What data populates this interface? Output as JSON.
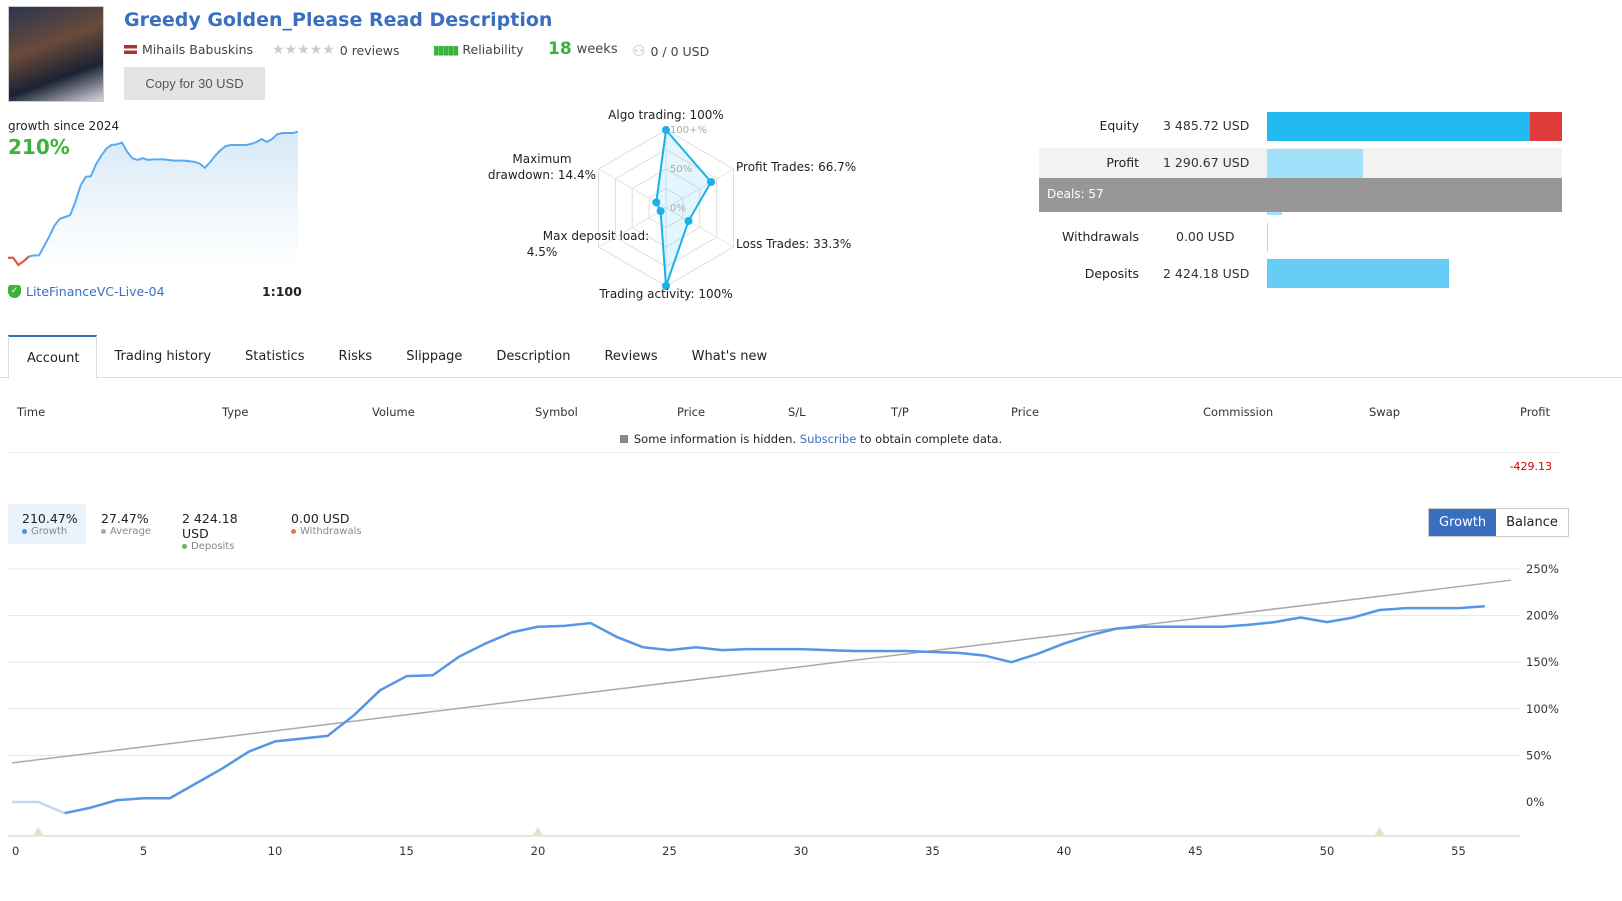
{
  "header": {
    "title": "Greedy Golden_Please Read Description",
    "author": "Mihails Babuskins",
    "reviews": "0 reviews",
    "reliability": "Reliability",
    "weeks_num": "18",
    "weeks_label": "weeks",
    "subscribers": "0 / 0 USD",
    "copy_button": "Copy for 30 USD",
    "rating_stars": 0
  },
  "summary": {
    "growth_label": "growth since 2024",
    "growth_value": "210%",
    "server": "LiteFinanceVC-Live-04",
    "leverage": "1:100"
  },
  "radar": {
    "labels": [
      "Algo trading: 100%",
      "Profit Trades: 66.7%",
      "Loss Trades: 33.3%",
      "Trading activity: 100%",
      "Max deposit load: 4.5%",
      "Maximum drawdown: 14.4%"
    ],
    "values": [
      100,
      66.7,
      33.3,
      100,
      4.5,
      14.4
    ],
    "scale": [
      "100+%",
      "50%",
      "0%"
    ]
  },
  "balance": {
    "equity_label": "Equity",
    "equity": "3 485.72 USD",
    "profit_label": "Profit",
    "profit": "1 290.67 USD",
    "deals": "Deals: 57",
    "withdrawals_label": "Withdrawals",
    "withdrawals": "0.00 USD",
    "deposits_label": "Deposits",
    "deposits": "2 424.18 USD",
    "colors": {
      "equity": "#22b8f0",
      "loss": "#e03c3c",
      "profit": "#a0e0f8",
      "deposits": "#66ccf5"
    }
  },
  "tabs": [
    "Account",
    "Trading history",
    "Statistics",
    "Risks",
    "Slippage",
    "Description",
    "Reviews",
    "What's new"
  ],
  "table": {
    "columns": [
      "Time",
      "Type",
      "Volume",
      "Symbol",
      "Price",
      "S/L",
      "T/P",
      "Price",
      "Commission",
      "Swap",
      "Profit"
    ],
    "notice_pre": "Some information is hidden.",
    "notice_link": "Subscribe",
    "notice_post": "to obtain complete data.",
    "total_profit": "-429.13"
  },
  "stats": [
    {
      "value": "210.47%",
      "label": "Growth",
      "color": "#4a90e2"
    },
    {
      "value": "27.47%",
      "label": "Average",
      "color": "#aaaaaa"
    },
    {
      "value": "2 424.18 USD",
      "label": "Deposits",
      "color": "#66bb44"
    },
    {
      "value": "0.00 USD",
      "label": "Withdrawals",
      "color": "#f07040"
    }
  ],
  "toggle": {
    "growth": "Growth",
    "balance": "Balance"
  },
  "chart_data": {
    "type": "line",
    "x": [
      0,
      1,
      2,
      3,
      4,
      5,
      6,
      7,
      8,
      9,
      10,
      11,
      12,
      13,
      14,
      15,
      16,
      17,
      18,
      19,
      20,
      21,
      22,
      23,
      24,
      25,
      26,
      27,
      28,
      29,
      30,
      31,
      32,
      33,
      34,
      35,
      36,
      37,
      38,
      39,
      40,
      41,
      42,
      43,
      44,
      45,
      46,
      47,
      48,
      49,
      50,
      51,
      52,
      53,
      54,
      55,
      56
    ],
    "series": [
      {
        "name": "Growth",
        "values": [
          0,
          0,
          -12,
          -6,
          2,
          4,
          4,
          20,
          36,
          54,
          65,
          68,
          71,
          93,
          120,
          135,
          136,
          156,
          170,
          182,
          188,
          189,
          192,
          177,
          166,
          163,
          166,
          163,
          164,
          164,
          164,
          163,
          162,
          162,
          162,
          161,
          160,
          157,
          150,
          159,
          170,
          179,
          186,
          188,
          188,
          188,
          188,
          190,
          193,
          198,
          193,
          198,
          206,
          208,
          208,
          208,
          210
        ],
        "color": "#5596e6"
      },
      {
        "name": "Average",
        "values_trend": [
          42,
          238
        ],
        "color": "#aaaaaa"
      }
    ],
    "xlim": [
      0,
      57
    ],
    "ylim": [
      0,
      250
    ],
    "xticks": [
      0,
      5,
      10,
      15,
      20,
      25,
      30,
      35,
      40,
      45,
      50,
      55
    ],
    "yticks": [
      "0%",
      "50%",
      "100%",
      "150%",
      "200%",
      "250%"
    ],
    "yvals": [
      0,
      50,
      100,
      150,
      200,
      250
    ],
    "deposit_markers": [
      1,
      20,
      52
    ],
    "grid": true
  }
}
